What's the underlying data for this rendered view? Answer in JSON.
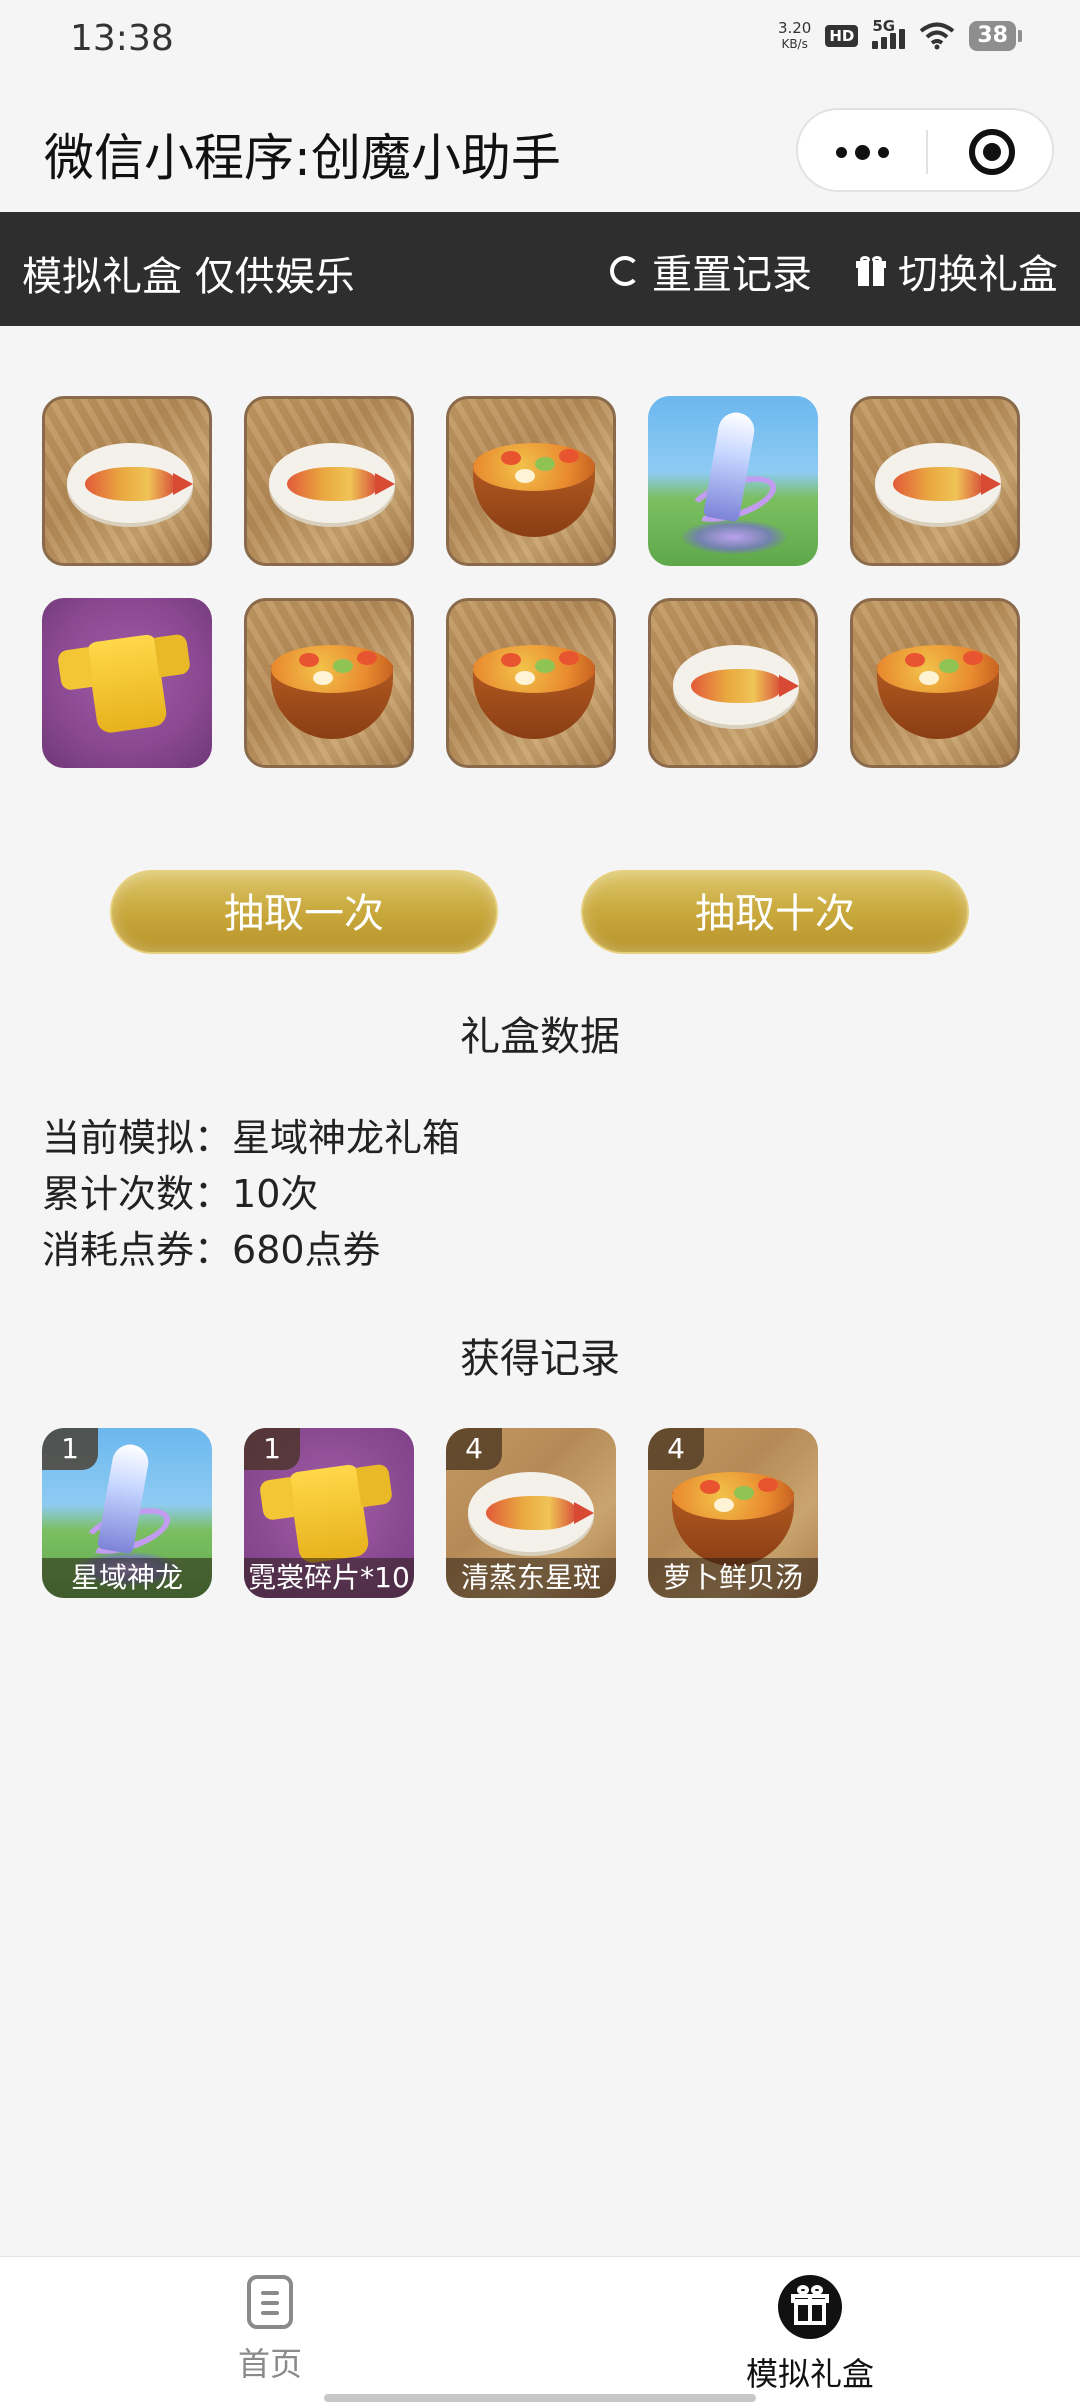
{
  "status_bar": {
    "time": "13:38",
    "net_speed_value": "3.20",
    "net_speed_unit": "KB/s",
    "hd_badge": "HD",
    "network": "5G",
    "battery": "38"
  },
  "title_bar": {
    "title": "微信小程序:创魔小助手",
    "more_icon": "more-dots-icon",
    "close_icon": "target-close-icon"
  },
  "toolbar": {
    "title": "模拟礼盒 仅供娱乐",
    "reset_label": "重置记录",
    "switch_label": "切换礼盒"
  },
  "draw_results": [
    [
      "fish-dish",
      "fish-dish",
      "soup-bowl",
      "star-dragon",
      "fish-dish"
    ],
    [
      "shirt-fragment",
      "soup-bowl",
      "soup-bowl",
      "fish-dish",
      "soup-bowl"
    ]
  ],
  "actions": {
    "draw_once": "抽取一次",
    "draw_ten": "抽取十次"
  },
  "stats": {
    "heading": "礼盒数据",
    "current_label": "当前模拟：",
    "current_value": "星域神龙礼箱",
    "count_label": "累计次数：",
    "count_value": "10次",
    "cost_label": "消耗点券：",
    "cost_value": "680点券"
  },
  "records": {
    "heading": "获得记录",
    "items": [
      {
        "count": "1",
        "name": "星域神龙",
        "kind": "star-dragon"
      },
      {
        "count": "1",
        "name": "霓裳碎片*10",
        "kind": "shirt-fragment"
      },
      {
        "count": "4",
        "name": "清蒸东星斑",
        "kind": "fish-dish"
      },
      {
        "count": "4",
        "name": "萝卜鲜贝汤",
        "kind": "soup-bowl"
      }
    ]
  },
  "tabbar": {
    "home_label": "首页",
    "gift_label": "模拟礼盒"
  }
}
